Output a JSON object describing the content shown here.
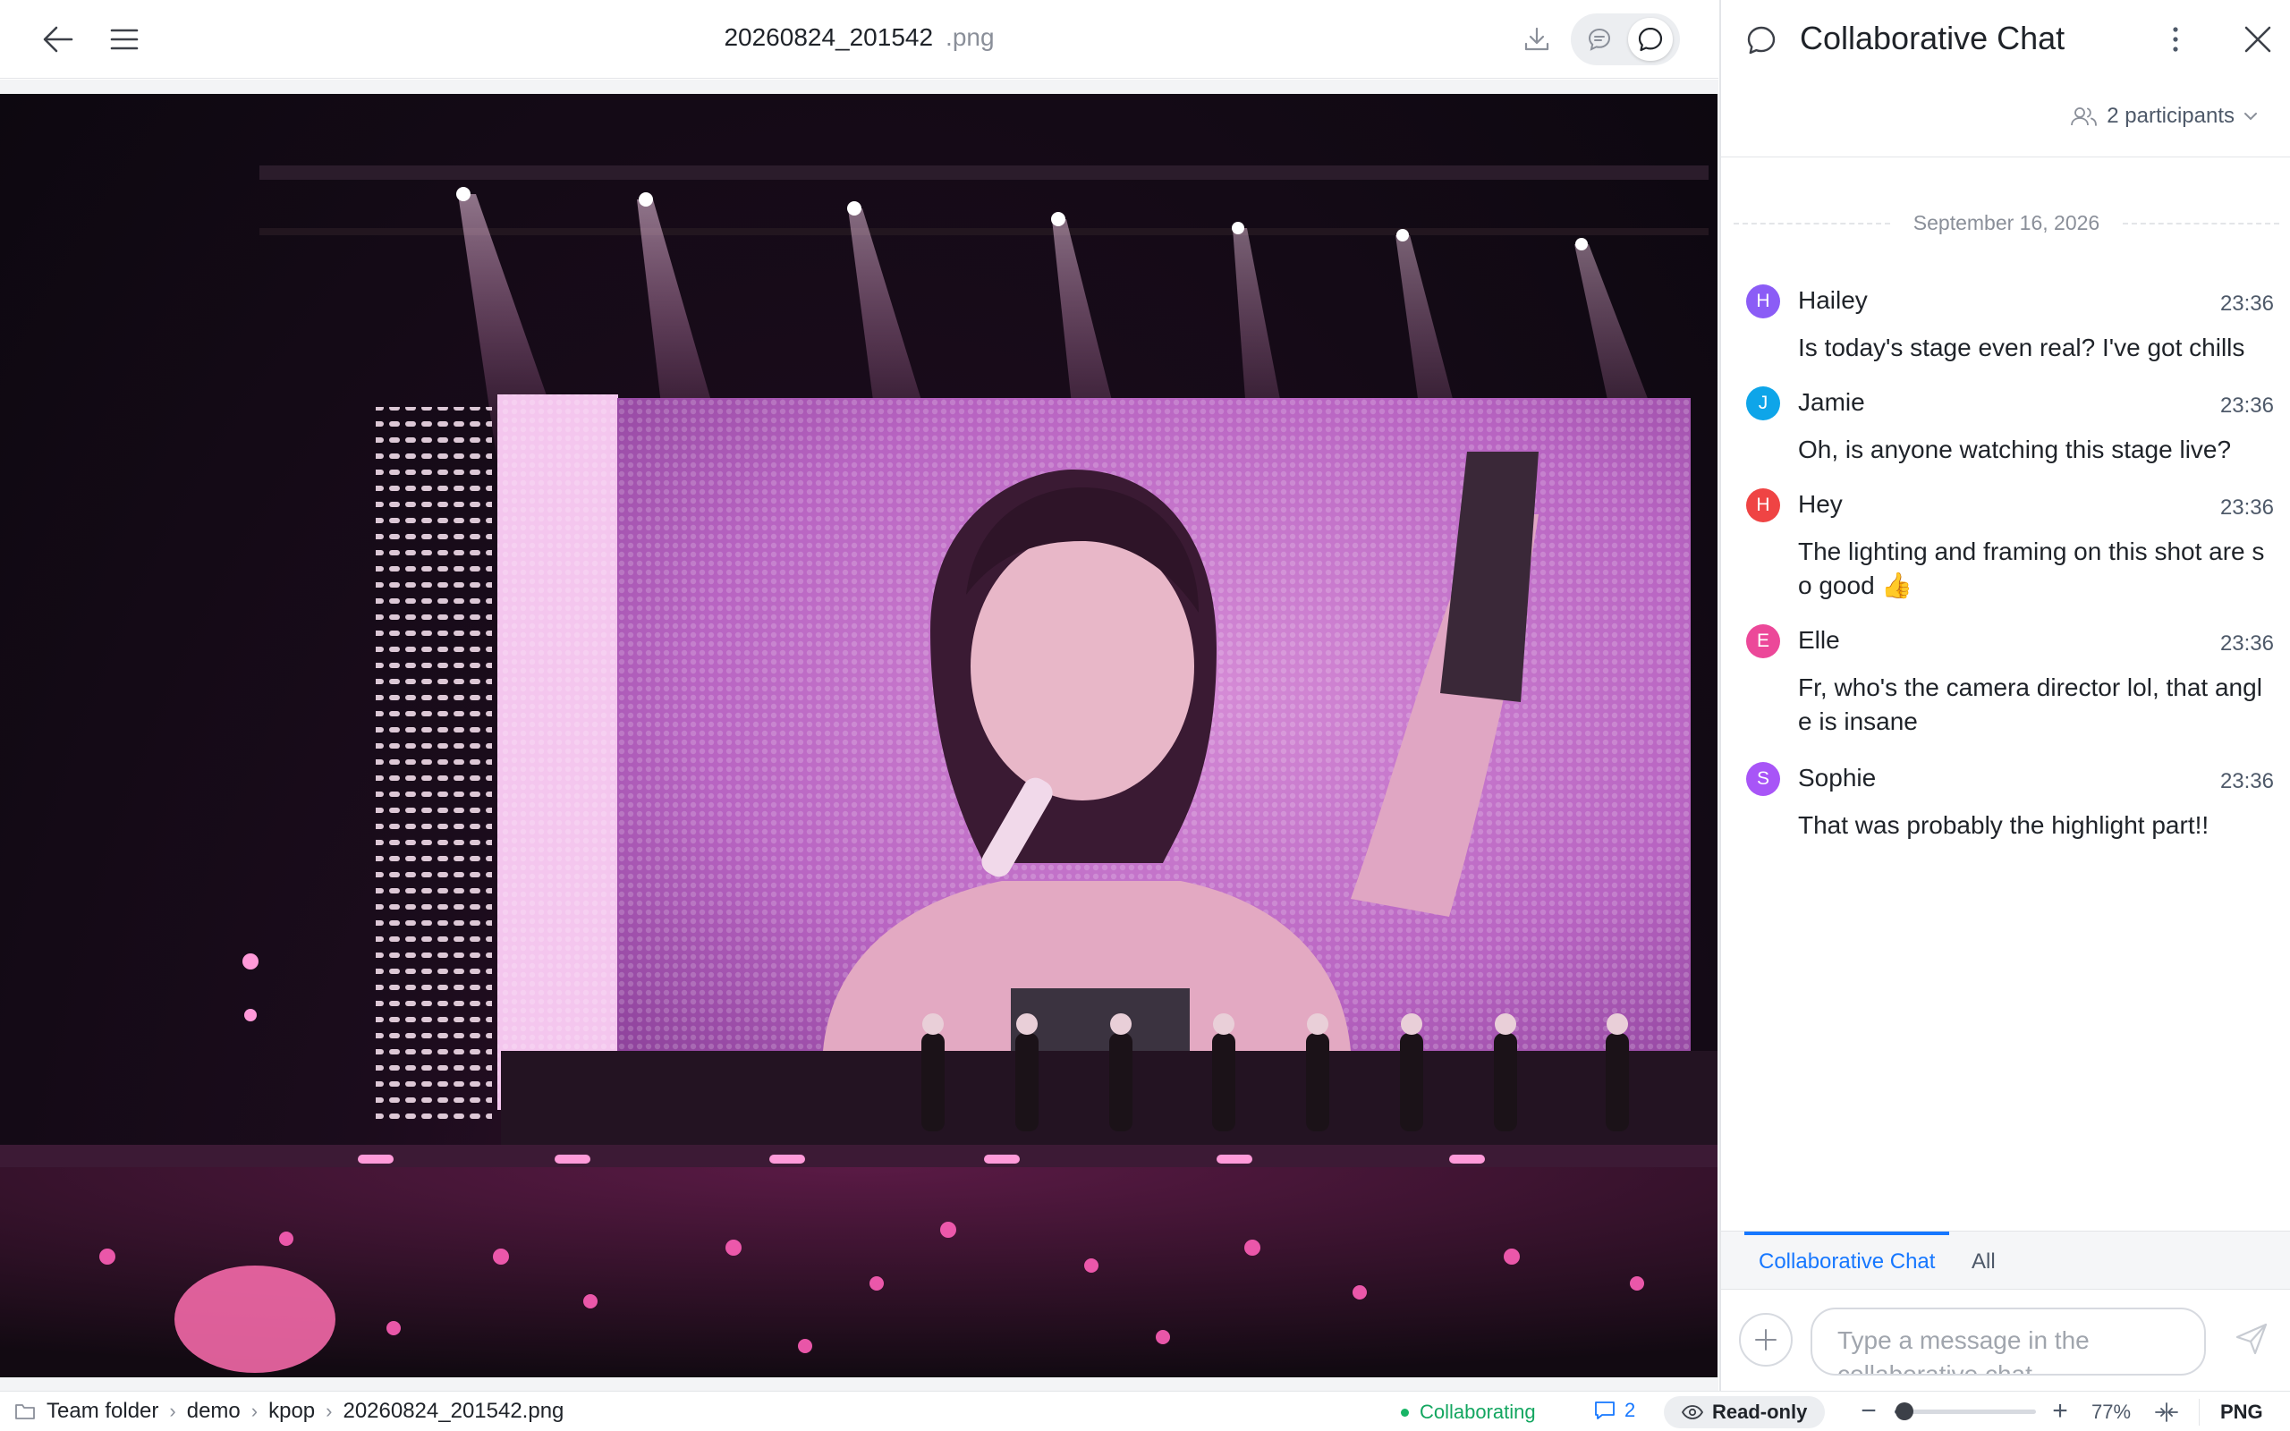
{
  "header": {
    "file_name": "20260824_201542",
    "file_ext": ".png"
  },
  "icons": {
    "back": "arrow-left-icon",
    "menu": "hamburger-menu-icon",
    "download": "download-icon",
    "comment": "comment-icon",
    "chat": "chat-bubble-icon",
    "more": "more-vertical-icon",
    "close": "close-icon",
    "participants": "people-icon",
    "add": "plus-icon",
    "send": "send-icon",
    "folder": "folder-icon",
    "read_only": "eye-icon",
    "fit": "fit-width-icon"
  },
  "chat": {
    "title": "Collaborative Chat",
    "participants_label": "2 participants",
    "date": "September 16, 2026",
    "messages": [
      {
        "initial": "H",
        "author": "Hailey",
        "time": "23:36",
        "text": "Is today's stage even real? I've got chills",
        "avatar_color": "#8b5cf6"
      },
      {
        "initial": "J",
        "author": "Jamie",
        "time": "23:36",
        "text": "Oh, is anyone watching this stage live?",
        "avatar_color": "#0ea5e9"
      },
      {
        "initial": "H",
        "author": "Hey",
        "time": "23:36",
        "text": "The lighting and framing on this shot are so good 👍",
        "avatar_color": "#ef4444"
      },
      {
        "initial": "E",
        "author": "Elle",
        "time": "23:36",
        "text": "Fr, who's the camera director lol, that angle is insane",
        "avatar_color": "#ec4899"
      },
      {
        "initial": "S",
        "author": "Sophie",
        "time": "23:36",
        "text": "That was probably the highlight part!!",
        "avatar_color": "#a855f7"
      }
    ],
    "tabs": [
      "Collaborative Chat",
      "All"
    ],
    "input_placeholder": "Type a message in the collaborative chat"
  },
  "statusbar": {
    "breadcrumb": [
      "Team folder",
      "demo",
      "kpop",
      "20260824_201542.png"
    ],
    "collab_status": "Collaborating",
    "comment_count": "2",
    "mode": "Read-only",
    "zoom_minus": "−",
    "zoom_plus": "+",
    "zoom_fraction": 0.77,
    "zoom_label": "77%",
    "format": "PNG"
  },
  "colors": {
    "accent": "#1677ff",
    "collab_green": "#13a660"
  }
}
